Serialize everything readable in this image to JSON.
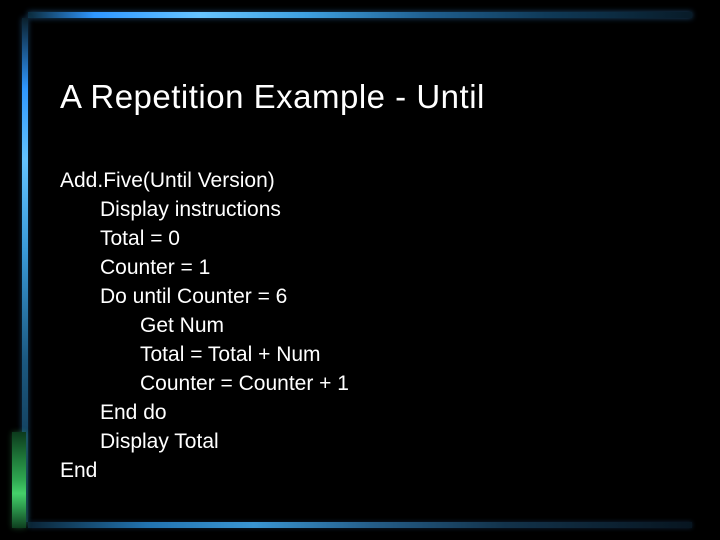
{
  "title": "A Repetition Example - Until",
  "code": {
    "l0": "Add.Five(Until Version)",
    "l1": "Display instructions",
    "l2": "Total = 0",
    "l3": "Counter = 1",
    "l4": "Do until Counter = 6",
    "l5": "Get Num",
    "l6": "Total = Total + Num",
    "l7": "Counter = Counter + 1",
    "l8": "End do",
    "l9": "Display Total",
    "l10": "End"
  }
}
